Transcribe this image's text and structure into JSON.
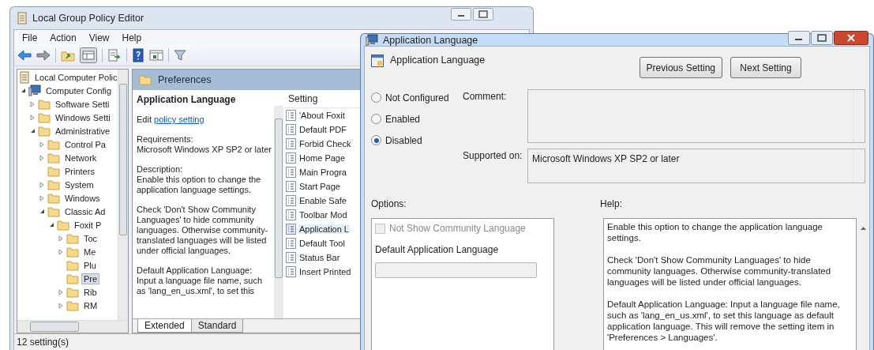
{
  "main_window": {
    "title": "Local Group Policy Editor",
    "menu": [
      "File",
      "Action",
      "View",
      "Help"
    ],
    "toolbar": {
      "tree_toggle_pressed": true
    },
    "tree": [
      {
        "label": "Local Computer Polic",
        "kind": "root",
        "selected": false,
        "children": [
          {
            "label": "Computer Config",
            "kind": "computer",
            "expanded": true,
            "selected": false,
            "children": [
              {
                "label": "Software Setti",
                "kind": "folder",
                "expanded": false,
                "selected": false
              },
              {
                "label": "Windows Setti",
                "kind": "folder",
                "expanded": false,
                "selected": false
              },
              {
                "label": "Administrative",
                "kind": "folder",
                "expanded": true,
                "selected": false,
                "children": [
                  {
                    "label": "Control Pa",
                    "kind": "folder",
                    "expanded": false,
                    "selected": false
                  },
                  {
                    "label": "Network",
                    "kind": "folder",
                    "expanded": false,
                    "selected": false
                  },
                  {
                    "label": "Printers",
                    "kind": "folder",
                    "selected": false
                  },
                  {
                    "label": "System",
                    "kind": "folder",
                    "expanded": false,
                    "selected": false
                  },
                  {
                    "label": "Windows",
                    "kind": "folder",
                    "expanded": false,
                    "selected": false
                  },
                  {
                    "label": "Classic Ad",
                    "kind": "folder",
                    "expanded": true,
                    "selected": false,
                    "children": [
                      {
                        "label": "Foxit P",
                        "kind": "folder",
                        "expanded": true,
                        "selected": false,
                        "children": [
                          {
                            "label": "Toc",
                            "kind": "folder",
                            "expanded": false,
                            "selected": false
                          },
                          {
                            "label": "Me",
                            "kind": "folder",
                            "expanded": false,
                            "selected": false
                          },
                          {
                            "label": "Plu",
                            "kind": "folder",
                            "selected": false
                          },
                          {
                            "label": "Pre",
                            "kind": "folder",
                            "selected": true
                          },
                          {
                            "label": "Rib",
                            "kind": "folder",
                            "expanded": false,
                            "selected": false
                          },
                          {
                            "label": "RM",
                            "kind": "folder",
                            "expanded": false,
                            "selected": false
                          }
                        ]
                      }
                    ]
                  }
                ]
              }
            ]
          }
        ]
      }
    ],
    "header": "Preferences",
    "description": {
      "title": "Application Language",
      "edit_prefix": "Edit",
      "edit_link": "policy setting",
      "paragraphs": [
        [
          "Requirements:",
          "Microsoft Windows XP SP2 or later"
        ],
        [
          "Description:",
          "Enable this option to change the application language settings."
        ],
        [
          "Check 'Don't Show Community Languages' to hide community languages. Otherwise community-translated languages will be listed under official languages."
        ],
        [
          "Default Application Language:",
          "Input a language file name, such as 'lang_en_us.xml', to set this"
        ]
      ]
    },
    "list": {
      "column": "Setting",
      "items": [
        {
          "label": "'About Foxit",
          "selected": false
        },
        {
          "label": "Default PDF",
          "selected": false
        },
        {
          "label": "Forbid Check",
          "selected": false
        },
        {
          "label": "Home Page",
          "selected": false
        },
        {
          "label": "Main Progra",
          "selected": false
        },
        {
          "label": "Start Page",
          "selected": false
        },
        {
          "label": "Enable Safe",
          "selected": false
        },
        {
          "label": "Toolbar Mod",
          "selected": false
        },
        {
          "label": "Application L",
          "selected": true
        },
        {
          "label": "Default Tool",
          "selected": false
        },
        {
          "label": "Status Bar",
          "selected": false
        },
        {
          "label": "Insert Printed",
          "selected": false
        }
      ]
    },
    "tabs": [
      {
        "label": "Extended",
        "selected": true
      },
      {
        "label": "Standard",
        "selected": false
      }
    ],
    "status_bar": "12 setting(s)"
  },
  "dialog": {
    "title": "Application Language",
    "setting_name": "Application Language",
    "buttons": [
      "Previous Setting",
      "Next Setting"
    ],
    "states": [
      {
        "label": "Not Configured",
        "selected": false
      },
      {
        "label": "Enabled",
        "selected": false
      },
      {
        "label": "Disabled",
        "selected": true
      }
    ],
    "comment_label": "Comment:",
    "supported_label": "Supported on:",
    "supported_value": "Microsoft Windows XP SP2 or later",
    "options_label": "Options:",
    "help_label": "Help:",
    "options": {
      "checkbox": {
        "label": "Not Show Community Language",
        "checked": false,
        "disabled": true
      },
      "field_label": "Default Application Language",
      "field_disabled": true
    },
    "help": [
      "Enable this option to change the application language settings.",
      "Check 'Don't Show Community Languages' to hide community languages. Otherwise community-translated languages will be listed under official languages.",
      "Default Application Language: Input a language file name, such as 'lang_en_us.xml', to set this language as default application language. This will remove the setting item in 'Preferences > Languages'."
    ]
  }
}
